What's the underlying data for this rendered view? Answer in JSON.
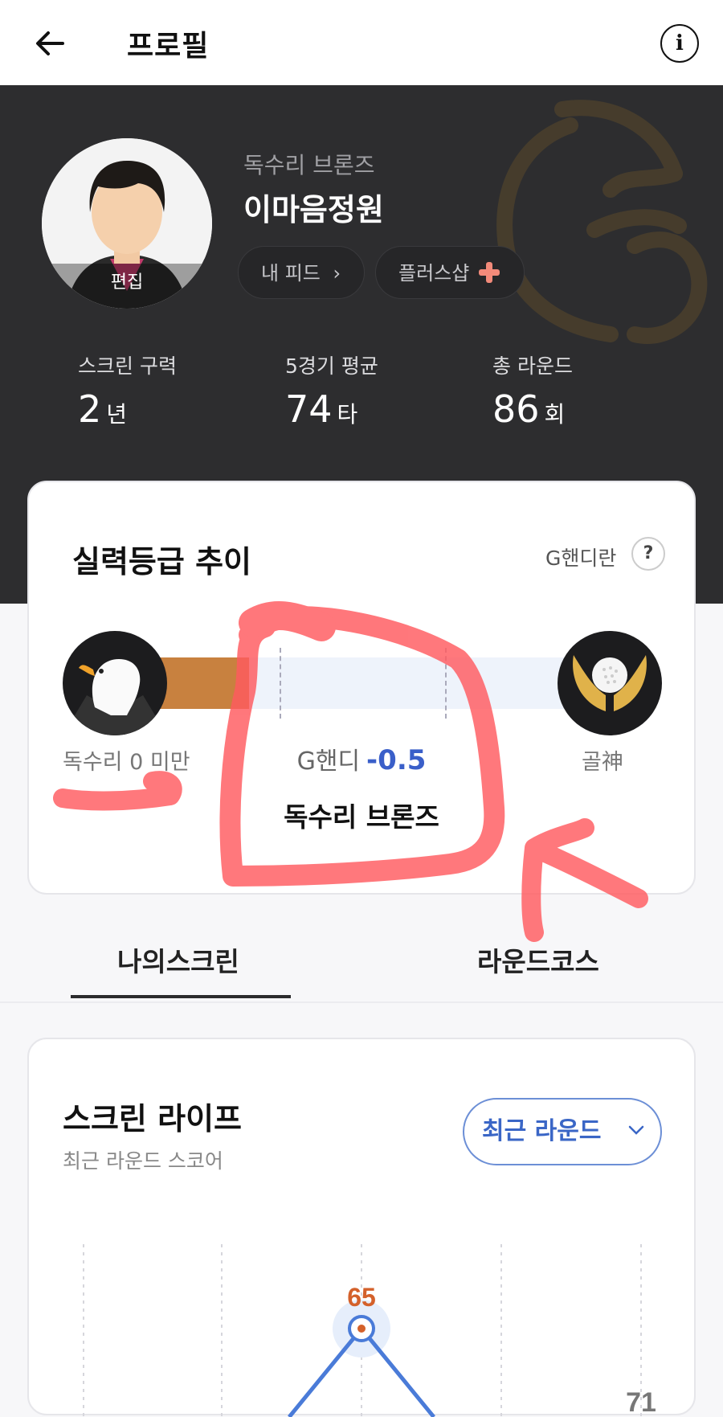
{
  "appbar": {
    "title": "프로필",
    "back_icon": "arrow-left-icon",
    "info_icon": "info-icon"
  },
  "profile": {
    "grade_name": "독수리 브론즈",
    "nickname": "이마음정원",
    "avatar_edit_label": "편집",
    "feed_button": "내 피드",
    "shop_button": "플러스샵"
  },
  "stats": [
    {
      "label": "스크린 구력",
      "value": "2",
      "unit": "년"
    },
    {
      "label": "5경기 평균",
      "value": "74",
      "unit": "타"
    },
    {
      "label": "총 라운드",
      "value": "86",
      "unit": "회"
    }
  ],
  "skill_card": {
    "title": "실력등급 추이",
    "help_label": "G핸디란",
    "help_icon": "?",
    "left_grade_label": "독수리 0 미만",
    "right_grade_label": "골神",
    "g_handi_label": "G핸디",
    "g_handi_value": "-0.5",
    "current_grade": "독수리 브론즈",
    "progress_fraction": 0.2
  },
  "tabs": [
    {
      "label": "나의스크린",
      "active": true
    },
    {
      "label": "라운드코스",
      "active": false
    }
  ],
  "screen_life": {
    "title": "스크린 라이프",
    "subtitle": "최근 라운드 스코어",
    "dropdown_label": "최근 라운드"
  },
  "chart_data": {
    "type": "line",
    "series": [
      {
        "values": [
          null,
          65,
          null,
          71
        ]
      }
    ],
    "labels_visible": [
      "65",
      "71"
    ]
  },
  "colors": {
    "hero_bg": "#2d2d2f",
    "accent_blue": "#3a5fc9",
    "bronze": "#c8813f",
    "score_orange": "#d4612b",
    "annotation_red": "#ff5a5f"
  }
}
